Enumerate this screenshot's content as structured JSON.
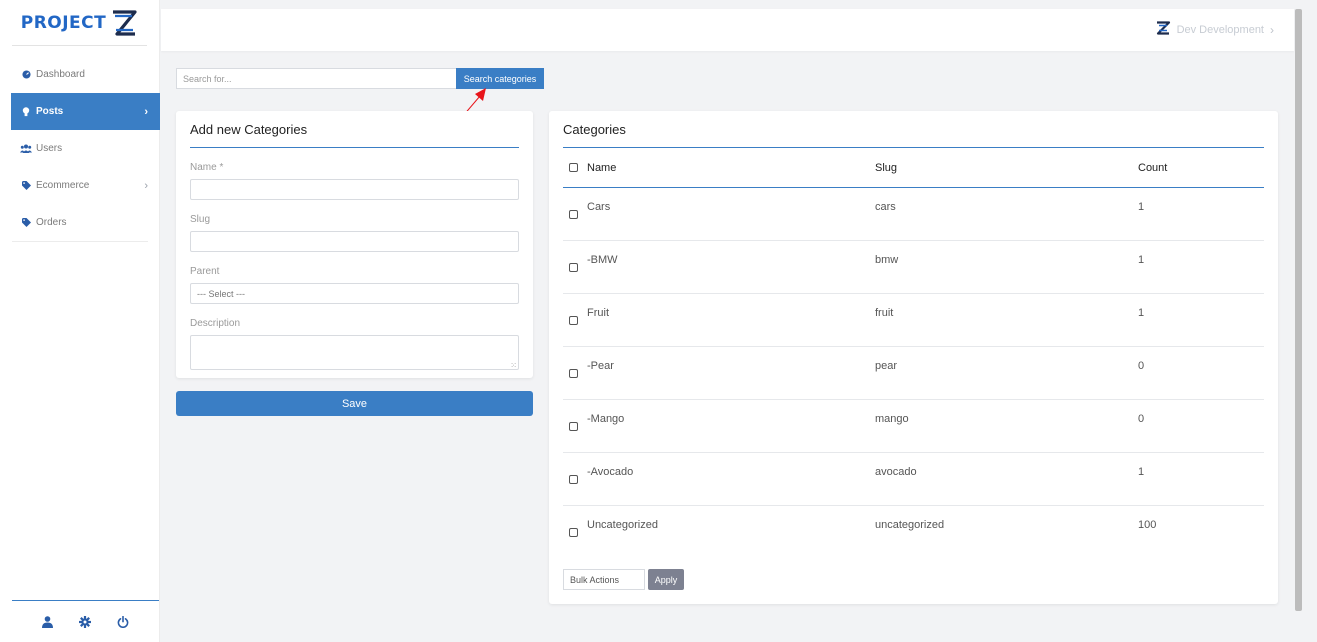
{
  "brand": {
    "name": "PROJECT",
    "color": "#2267c5"
  },
  "topbar": {
    "user_label": "Dev Development",
    "user_icon": "logo-z-icon"
  },
  "sidebar": {
    "items": [
      {
        "label": "Dashboard",
        "icon": "dashboard-icon"
      },
      {
        "label": "Posts",
        "icon": "lightbulb-icon",
        "active": true
      },
      {
        "label": "Users",
        "icon": "users-icon"
      },
      {
        "label": "Ecommerce",
        "icon": "tag-icon"
      },
      {
        "label": "Orders",
        "icon": "tag-icon"
      }
    ],
    "footer_icons": [
      "user-icon",
      "gear-icon",
      "power-icon"
    ]
  },
  "search": {
    "placeholder": "Search for...",
    "button_label": "Search categories"
  },
  "add_form": {
    "title": "Add new Categories",
    "name_label": "Name *",
    "slug_label": "Slug",
    "parent_label": "Parent",
    "parent_selected": "--- Select ---",
    "description_label": "Description",
    "save_label": "Save"
  },
  "categories": {
    "title": "Categories",
    "columns": {
      "name": "Name",
      "slug": "Slug",
      "count": "Count"
    },
    "rows": [
      {
        "name": "Cars",
        "slug": "cars",
        "count": "1"
      },
      {
        "name": "-BMW",
        "slug": "bmw",
        "count": "1"
      },
      {
        "name": "Fruit",
        "slug": "fruit",
        "count": "1"
      },
      {
        "name": "-Pear",
        "slug": "pear",
        "count": "0"
      },
      {
        "name": "-Mango",
        "slug": "mango",
        "count": "0"
      },
      {
        "name": "-Avocado",
        "slug": "avocado",
        "count": "1"
      },
      {
        "name": "Uncategorized",
        "slug": "uncategorized",
        "count": "100"
      }
    ],
    "bulk_actions_label": "Bulk Actions",
    "apply_label": "Apply"
  },
  "colors": {
    "accent": "#3a7ec5",
    "annotation": "#e8141a",
    "apply": "#7d8191"
  }
}
